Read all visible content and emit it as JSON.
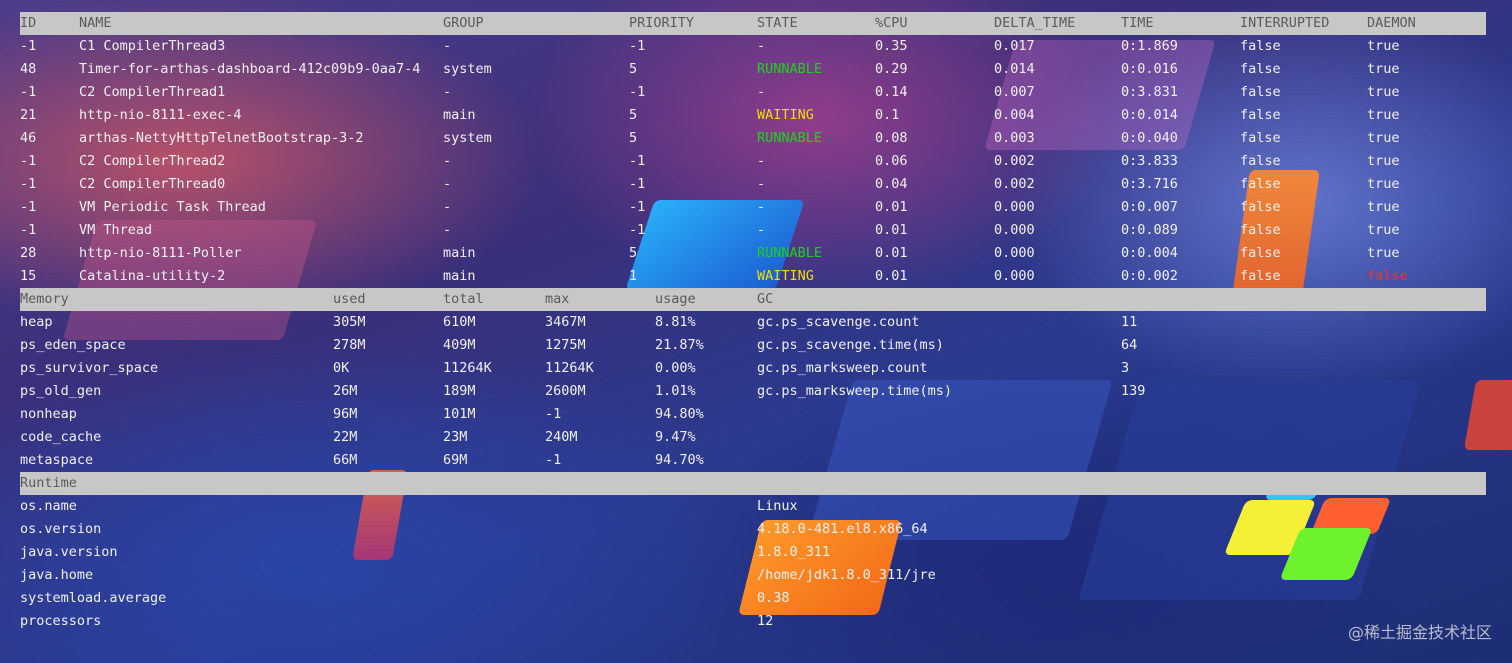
{
  "threads": {
    "headers": [
      "ID",
      "NAME",
      "GROUP",
      "PRIORITY",
      "STATE",
      "%CPU",
      "DELTA_TIME",
      "TIME",
      "INTERRUPTED",
      "DAEMON"
    ],
    "rows": [
      [
        "-1",
        "C1 CompilerThread3",
        "-",
        "-1",
        "-",
        "0.35",
        "0.017",
        "0:1.869",
        "false",
        "true"
      ],
      [
        "48",
        "Timer-for-arthas-dashboard-412c09b9-0aa7-4",
        "system",
        "5",
        "RUNNABLE",
        "0.29",
        "0.014",
        "0:0.016",
        "false",
        "true"
      ],
      [
        "-1",
        "C2 CompilerThread1",
        "-",
        "-1",
        "-",
        "0.14",
        "0.007",
        "0:3.831",
        "false",
        "true"
      ],
      [
        "21",
        "http-nio-8111-exec-4",
        "main",
        "5",
        "WAITING",
        "0.1",
        "0.004",
        "0:0.014",
        "false",
        "true"
      ],
      [
        "46",
        "arthas-NettyHttpTelnetBootstrap-3-2",
        "system",
        "5",
        "RUNNABLE",
        "0.08",
        "0.003",
        "0:0.040",
        "false",
        "true"
      ],
      [
        "-1",
        "C2 CompilerThread2",
        "-",
        "-1",
        "-",
        "0.06",
        "0.002",
        "0:3.833",
        "false",
        "true"
      ],
      [
        "-1",
        "C2 CompilerThread0",
        "-",
        "-1",
        "-",
        "0.04",
        "0.002",
        "0:3.716",
        "false",
        "true"
      ],
      [
        "-1",
        "VM Periodic Task Thread",
        "-",
        "-1",
        "-",
        "0.01",
        "0.000",
        "0:0.007",
        "false",
        "true"
      ],
      [
        "-1",
        "VM Thread",
        "-",
        "-1",
        "-",
        "0.01",
        "0.000",
        "0:0.089",
        "false",
        "true"
      ],
      [
        "28",
        "http-nio-8111-Poller",
        "main",
        "5",
        "RUNNABLE",
        "0.01",
        "0.000",
        "0:0.004",
        "false",
        "true"
      ],
      [
        "15",
        "Catalina-utility-2",
        "main",
        "1",
        "WAITING",
        "0.01",
        "0.000",
        "0:0.002",
        "false",
        "false"
      ]
    ]
  },
  "memory": {
    "headers": [
      "Memory",
      "used",
      "total",
      "max",
      "usage",
      "GC"
    ],
    "rows": [
      [
        "heap",
        "305M",
        "610M",
        "3467M",
        "8.81%"
      ],
      [
        "ps_eden_space",
        "278M",
        "409M",
        "1275M",
        "21.87%"
      ],
      [
        "ps_survivor_space",
        "0K",
        "11264K",
        "11264K",
        "0.00%"
      ],
      [
        "ps_old_gen",
        "26M",
        "189M",
        "2600M",
        "1.01%"
      ],
      [
        "nonheap",
        "96M",
        "101M",
        "-1",
        "94.80%"
      ],
      [
        "code_cache",
        "22M",
        "23M",
        "240M",
        "9.47%"
      ],
      [
        "metaspace",
        "66M",
        "69M",
        "-1",
        "94.70%"
      ]
    ],
    "gc": [
      [
        "gc.ps_scavenge.count",
        "11"
      ],
      [
        "gc.ps_scavenge.time(ms)",
        "64"
      ],
      [
        "gc.ps_marksweep.count",
        "3"
      ],
      [
        "gc.ps_marksweep.time(ms)",
        "139"
      ]
    ]
  },
  "runtime": {
    "header": "Runtime",
    "rows": [
      [
        "os.name",
        "Linux"
      ],
      [
        "os.version",
        "4.18.0-481.el8.x86_64"
      ],
      [
        "java.version",
        "1.8.0_311"
      ],
      [
        "java.home",
        "/home/jdk1.8.0_311/jre"
      ],
      [
        "systemload.average",
        "0.38"
      ],
      [
        "processors",
        "12"
      ]
    ]
  },
  "colors": {
    "state_runnable": "#1fd11f",
    "state_waiting": "#f2df00",
    "daemon_false": "#ff2d2d",
    "header_bar": "#c7c7c7",
    "header_text": "#5a5a5a",
    "text": "#f0f0f0"
  },
  "watermark": "@稀土掘金技术社区"
}
